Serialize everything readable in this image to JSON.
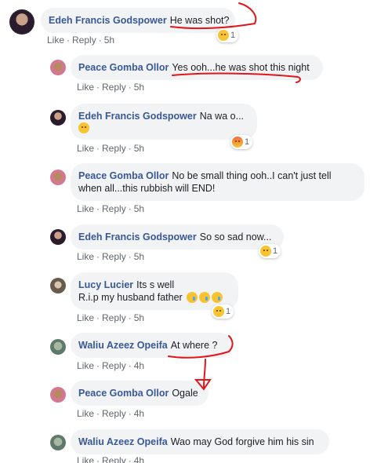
{
  "comments": [
    {
      "author": "Edeh Francis Godspower",
      "text": "He was shot?",
      "like": "Like",
      "reply": "Reply",
      "time": "5h",
      "reaction_count": "1"
    },
    {
      "author": "Peace Gomba Ollor",
      "text": "Yes ooh...he was shot this night",
      "like": "Like",
      "reply": "Reply",
      "time": "5h"
    },
    {
      "author": "Edeh Francis Godspower",
      "text": "Na wa o...",
      "like": "Like",
      "reply": "Reply",
      "time": "5h",
      "reaction_count": "1"
    },
    {
      "author": "Peace Gomba Ollor",
      "text": "No be small thing ooh..I can't just tell",
      "text2": "when all...this rubbish will END!",
      "like": "Like",
      "reply": "Reply",
      "time": "5h"
    },
    {
      "author": "Edeh Francis Godspower",
      "text": "So so sad now...",
      "like": "Like",
      "reply": "Reply",
      "time": "5h",
      "reaction_count": "1"
    },
    {
      "author": "Lucy Lucier",
      "text": "Its s well",
      "text2": "R.i.p my husband father",
      "like": "Like",
      "reply": "Reply",
      "time": "5h",
      "reaction_count": "1"
    },
    {
      "author": "Waliu Azeez Opeifa",
      "text": "At where ?",
      "like": "Like",
      "reply": "Reply",
      "time": "4h"
    },
    {
      "author": "Peace Gomba Ollor",
      "text": "Ogale",
      "like": "Like",
      "reply": "Reply",
      "time": "4h"
    },
    {
      "author": "Waliu Azeez Opeifa",
      "text": "Wao may God forgive him his sin",
      "like": "Like",
      "reply": "Reply",
      "time": "4h"
    }
  ],
  "colors": {
    "author": "#385898",
    "bubble": "#f2f3f5",
    "meta": "#606770",
    "ink": "#e0161b"
  },
  "icons": [
    "sad-reaction-icon",
    "angry-reaction-icon",
    "pensive-emoji-icon",
    "crying-emoji-icon"
  ]
}
